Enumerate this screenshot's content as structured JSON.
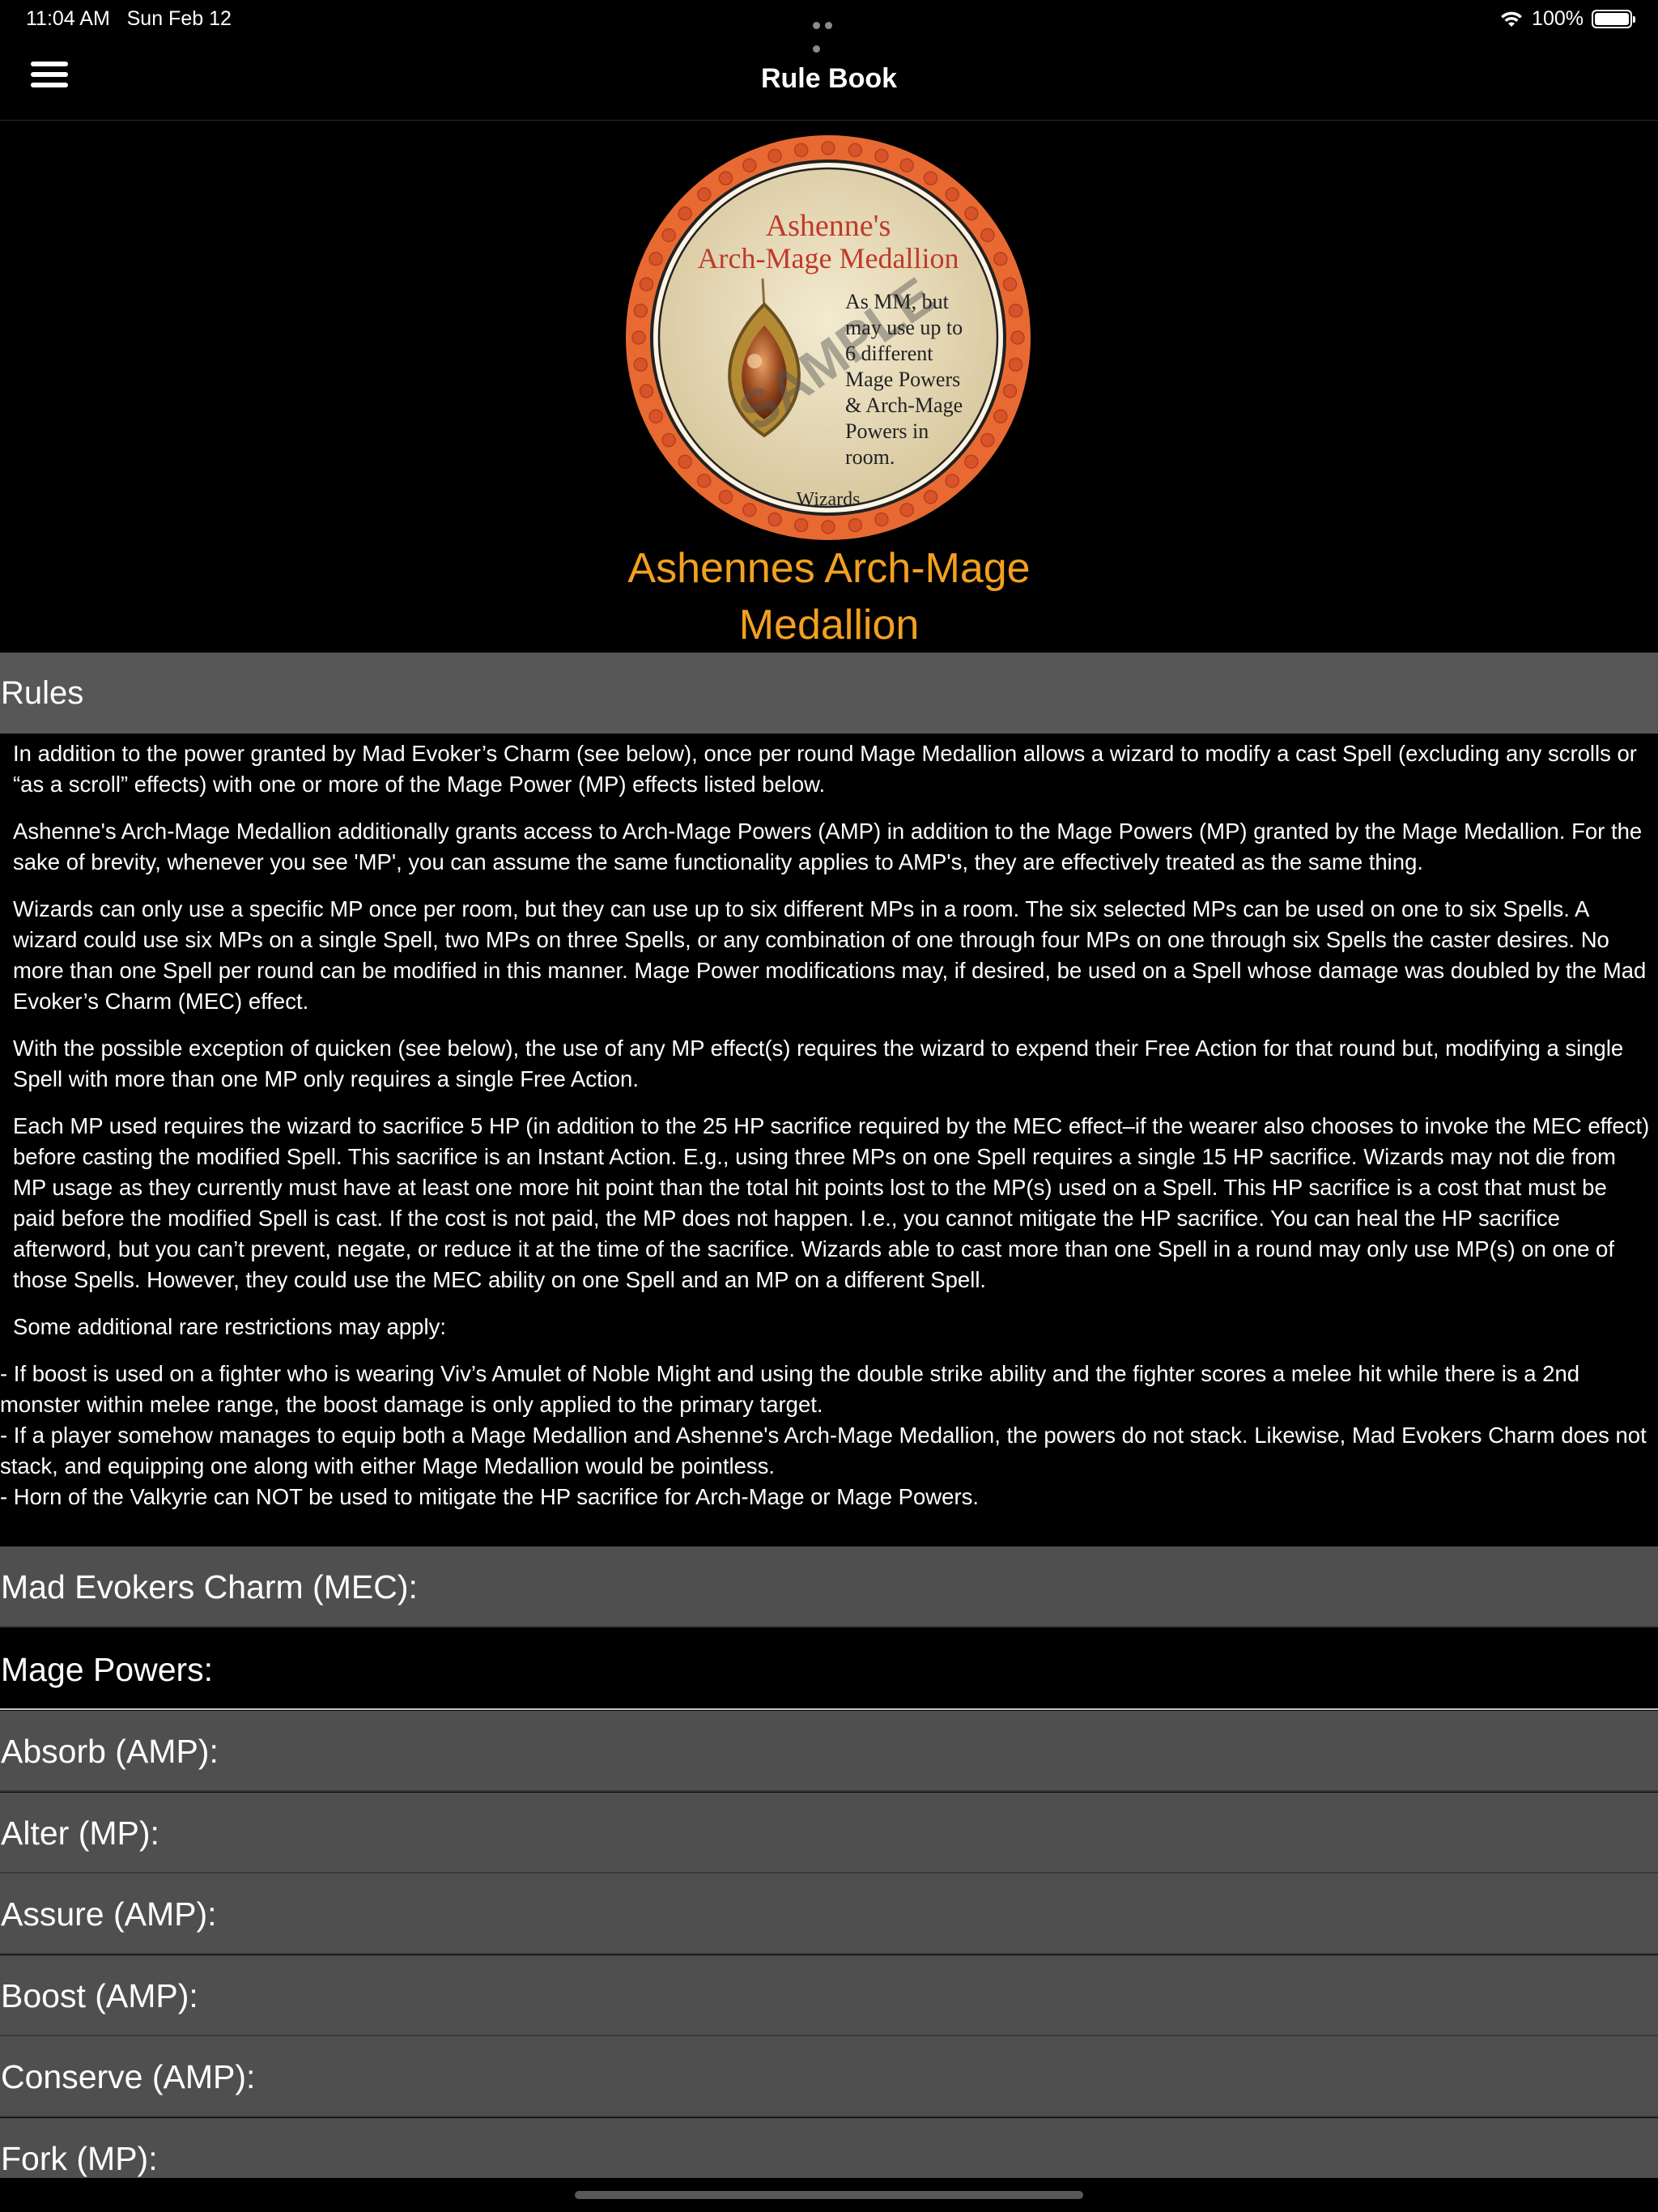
{
  "status_bar": {
    "time": "11:04 AM",
    "date": "Sun Feb 12",
    "battery": "100%"
  },
  "nav": {
    "title": "Rule Book",
    "menu_icon": "hamburger-menu-icon"
  },
  "item": {
    "title": "Ashennes Arch-Mage Medallion",
    "medallion": {
      "name_line1": "Ashenne's",
      "name_line2": "Arch-Mage Medallion",
      "desc": [
        "As MM, but",
        "may use up to",
        "6 different",
        "Mage Powers",
        "& Arch-Mage",
        "Powers in",
        "room."
      ],
      "footer": "Wizards",
      "watermark": "SAMPLE"
    }
  },
  "rules": {
    "header": "Rules",
    "paragraphs": [
      "In addition to the power granted by Mad Evoker’s Charm (see below), once per round Mage Medallion allows a wizard to modify a cast Spell (excluding any scrolls or “as a scroll” effects) with one or more of the Mage Power (MP) effects listed below.",
      "Ashenne's Arch-Mage Medallion additionally grants access to Arch-Mage Powers (AMP) in addition to the Mage Powers (MP) granted by the Mage Medallion. For the sake of brevity, whenever you see 'MP', you can assume the same functionality applies to AMP's, they are effectively treated as the same thing.",
      "Wizards can only use a specific MP once per room, but they can use up to six different MPs in a room. The six selected MPs can be used on one to six Spells. A wizard could use six MPs on a single Spell, two MPs on three Spells, or any combination of one through four MPs on one through six Spells the caster desires. No more than one Spell per round can be modified in this manner. Mage Power modifications may, if desired, be used on a Spell whose damage was doubled by the Mad Evoker’s Charm (MEC) effect.",
      "With the possible exception of quicken (see below), the use of any MP effect(s) requires the wizard to expend their Free Action for that round but, modifying a single Spell with more than one MP only requires a single Free Action.",
      "Each MP used requires the wizard to sacrifice 5 HP (in addition to the 25 HP sacrifice required by the MEC effect–if the wearer also chooses to invoke the MEC effect) before casting the modified Spell. This sacrifice is an Instant Action. E.g., using three MPs on one Spell requires a single 15 HP sacrifice. Wizards may not die from MP usage as they currently must have at least one more hit point than the total hit points lost to the MP(s) used on a Spell. This HP sacrifice is a cost that must be paid before the modified Spell is cast. If the cost is not paid, the MP does not happen. I.e., you cannot mitigate the HP sacrifice. You can heal the HP sacrifice afterword, but you can’t prevent, negate, or reduce it at the time of the sacrifice. Wizards able to cast more than one Spell in a round may only use MP(s) on one of those Spells. However, they could use the MEC ability on one Spell and an MP on a different Spell.",
      "Some additional rare restrictions may apply:"
    ],
    "notes": [
      "- If boost is used on a fighter who is wearing Viv’s Amulet of Noble Might and using the double strike ability and the fighter scores a melee hit while there is a 2nd monster within melee range, the boost damage is only applied to the primary target.",
      "- If a player somehow manages to equip both a Mage Medallion and Ashenne's Arch-Mage Medallion, the powers do not stack. Likewise, Mad Evokers Charm does not stack, and equipping one along with either Mage Medallion would be pointless.",
      "- Horn of the Valkyrie can NOT be used to mitigate the HP sacrifice for Arch-Mage or Mage Powers."
    ]
  },
  "sections": [
    {
      "label": "Mad Evokers Charm (MEC):"
    },
    {
      "label": "Mage Powers:"
    },
    {
      "label": "Absorb (AMP):"
    },
    {
      "label": "Alter (MP):"
    },
    {
      "label": "Assure (AMP):"
    },
    {
      "label": "Boost (AMP):"
    },
    {
      "label": "Conserve (AMP):"
    },
    {
      "label": "Fork (MP):"
    }
  ],
  "colors": {
    "title_orange": "#f2a020",
    "section_gray": "#4f4f4f",
    "header_gray": "#575757",
    "medallion_orange": "#e86a32"
  }
}
